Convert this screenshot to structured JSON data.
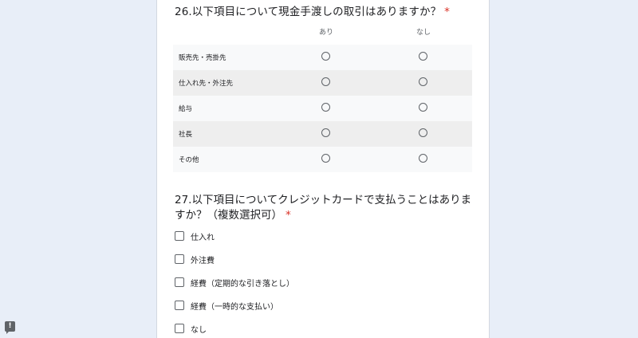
{
  "q26": {
    "title": "26.以下項目について現金手渡しの取引はありますか？",
    "required_mark": "*",
    "columns": [
      "あり",
      "なし"
    ],
    "rows": [
      "販売先・売掛先",
      "仕入れ先・外注先",
      "給与",
      "社長",
      "その他"
    ]
  },
  "q27": {
    "title": "27.以下項目についてクレジットカードで支払うことはありますか？（複数選択可）",
    "required_mark": "*",
    "options": [
      "仕入れ",
      "外注費",
      "経費（定期的な引き落とし）",
      "経費（一時的な支払い）",
      "なし"
    ]
  },
  "feedback": {
    "icon": "report-feedback-icon",
    "glyph": "!"
  },
  "colors": {
    "required": "#d93025",
    "background": "#e8eef8"
  }
}
